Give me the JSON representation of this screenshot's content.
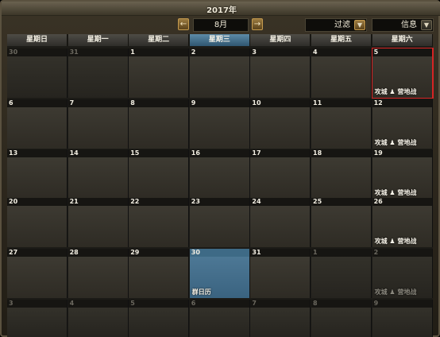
{
  "title": "2017年",
  "month": "8月",
  "nav": {
    "prev": "←",
    "next": "→"
  },
  "filter": {
    "label": "过滤",
    "arrow": "▼"
  },
  "info": {
    "label": "信息",
    "arrow": "▼"
  },
  "weekdays": [
    "星期日",
    "星期一",
    "星期二",
    "星期三",
    "星期四",
    "星期五",
    "星期六"
  ],
  "active_weekday_index": 3,
  "weeks": [
    [
      {
        "day": "30",
        "other": true
      },
      {
        "day": "31",
        "other": true
      },
      {
        "day": "1"
      },
      {
        "day": "2"
      },
      {
        "day": "3"
      },
      {
        "day": "4"
      },
      {
        "day": "5",
        "event": "攻城 ♟ 营地战",
        "selected": true
      }
    ],
    [
      {
        "day": "6"
      },
      {
        "day": "7"
      },
      {
        "day": "8"
      },
      {
        "day": "9"
      },
      {
        "day": "10"
      },
      {
        "day": "11"
      },
      {
        "day": "12",
        "event": "攻城 ♟ 营地战"
      }
    ],
    [
      {
        "day": "13"
      },
      {
        "day": "14"
      },
      {
        "day": "15"
      },
      {
        "day": "16"
      },
      {
        "day": "17"
      },
      {
        "day": "18"
      },
      {
        "day": "19",
        "event": "攻城 ♟ 营地战"
      }
    ],
    [
      {
        "day": "20"
      },
      {
        "day": "21"
      },
      {
        "day": "22"
      },
      {
        "day": "23"
      },
      {
        "day": "24"
      },
      {
        "day": "25"
      },
      {
        "day": "26",
        "event": "攻城 ♟ 营地战"
      }
    ],
    [
      {
        "day": "27"
      },
      {
        "day": "28"
      },
      {
        "day": "29"
      },
      {
        "day": "30",
        "event": "群日历",
        "today": true
      },
      {
        "day": "31"
      },
      {
        "day": "1",
        "other": true
      },
      {
        "day": "2",
        "other": true,
        "event": "攻城 ♟ 营地战"
      }
    ],
    [
      {
        "day": "3",
        "other": true
      },
      {
        "day": "4",
        "other": true
      },
      {
        "day": "5",
        "other": true
      },
      {
        "day": "6",
        "other": true
      },
      {
        "day": "7",
        "other": true
      },
      {
        "day": "8",
        "other": true
      },
      {
        "day": "9",
        "other": true
      }
    ]
  ]
}
